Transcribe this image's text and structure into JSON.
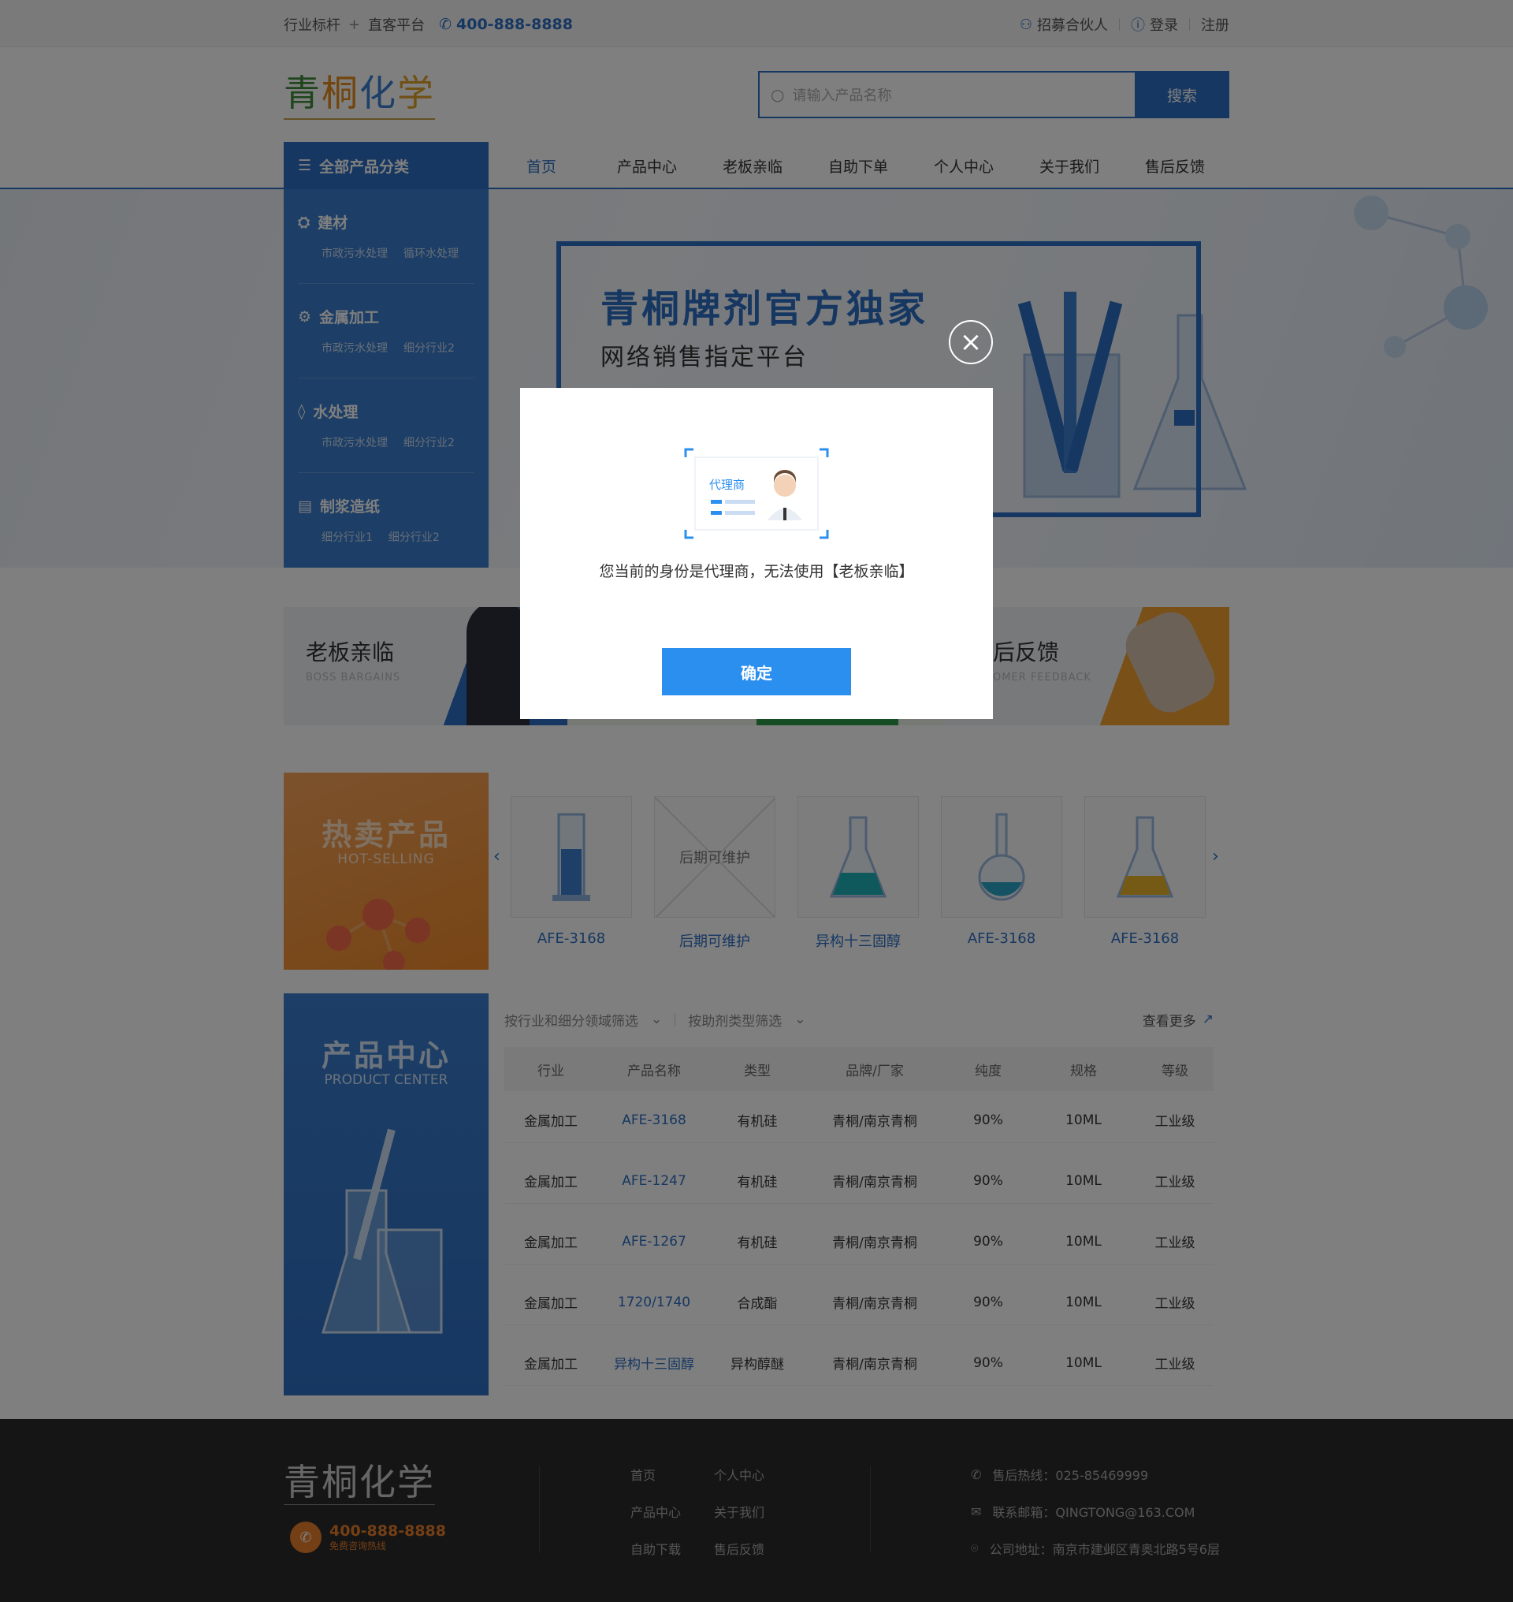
{
  "topbar": {
    "slogan_left": "行业标杆",
    "plus": "+",
    "slogan_right": "直客平台",
    "phone": "400-888-8888",
    "partner": "招募合伙人",
    "login": "登录",
    "register": "注册"
  },
  "header": {
    "logo": [
      "青",
      "桐",
      "化",
      "学"
    ],
    "search_placeholder": "请输入产品名称",
    "search_button": "搜索"
  },
  "nav": {
    "all_categories": "全部产品分类",
    "items": [
      "首页",
      "产品中心",
      "老板亲临",
      "自助下单",
      "个人中心",
      "关于我们",
      "售后反馈"
    ]
  },
  "categories": [
    {
      "title": "建材",
      "subs": [
        "市政污水处理",
        "循环水处理"
      ]
    },
    {
      "title": "金属加工",
      "subs": [
        "市政污水处理",
        "细分行业2"
      ]
    },
    {
      "title": "水处理",
      "subs": [
        "市政污水处理",
        "细分行业2"
      ]
    },
    {
      "title": "制浆造纸",
      "subs": [
        "细分行业1",
        "细分行业2"
      ]
    }
  ],
  "banner": {
    "title": "青桐牌剂官方独家",
    "subtitle": "网络销售指定平台"
  },
  "features": [
    {
      "title": "老板亲临",
      "subtitle": "BOSS BARGAINS"
    },
    {
      "title": "后反馈",
      "subtitle": "OMER FEEDBACK"
    }
  ],
  "hot": {
    "title": "热卖产品",
    "subtitle": "HOT-SELLING",
    "products": [
      {
        "name": "AFE-3168",
        "placeholder": ""
      },
      {
        "name": "后期可维护",
        "placeholder": "后期可维护"
      },
      {
        "name": "异构十三固醇",
        "placeholder": ""
      },
      {
        "name": "AFE-3168",
        "placeholder": ""
      },
      {
        "name": "AFE-3168",
        "placeholder": ""
      }
    ]
  },
  "product_center": {
    "title": "产品中心",
    "subtitle": "PRODUCT CENTER",
    "filter_industry": "按行业和细分领域筛选",
    "filter_type": "按助剂类型筛选",
    "more": "查看更多",
    "headers": [
      "行业",
      "产品名称",
      "类型",
      "品牌/厂家",
      "纯度",
      "规格",
      "等级"
    ],
    "rows": [
      [
        "金属加工",
        "AFE-3168",
        "有机硅",
        "青桐/南京青桐",
        "90%",
        "10ML",
        "工业级"
      ],
      [
        "金属加工",
        "AFE-1247",
        "有机硅",
        "青桐/南京青桐",
        "90%",
        "10ML",
        "工业级"
      ],
      [
        "金属加工",
        "AFE-1267",
        "有机硅",
        "青桐/南京青桐",
        "90%",
        "10ML",
        "工业级"
      ],
      [
        "金属加工",
        "1720/1740",
        "合成酯",
        "青桐/南京青桐",
        "90%",
        "10ML",
        "工业级"
      ],
      [
        "金属加工",
        "异构十三固醇",
        "异构醇醚",
        "青桐/南京青桐",
        "90%",
        "10ML",
        "工业级"
      ]
    ]
  },
  "footer": {
    "logo": "青桐化学",
    "phone": "400-888-8888",
    "phone_tip": "免费咨询热线",
    "links": [
      "首页",
      "个人中心",
      "产品中心",
      "关于我们",
      "自助下载",
      "售后反馈"
    ],
    "hotline": "售后热线：025-85469999",
    "email": "联系邮箱：QINGTONG@163.COM",
    "address": "公司地址：南京市建邺区青奥北路5号6层"
  },
  "modal": {
    "card_label": "代理商",
    "message": "您当前的身份是代理商，无法使用【老板亲临】",
    "confirm": "确定"
  },
  "colors": {
    "brand_blue": "#2d6fc3",
    "orange": "#f08a2a",
    "confirm_blue": "#2b8ff0",
    "footer_bg": "#2b2b2b"
  }
}
